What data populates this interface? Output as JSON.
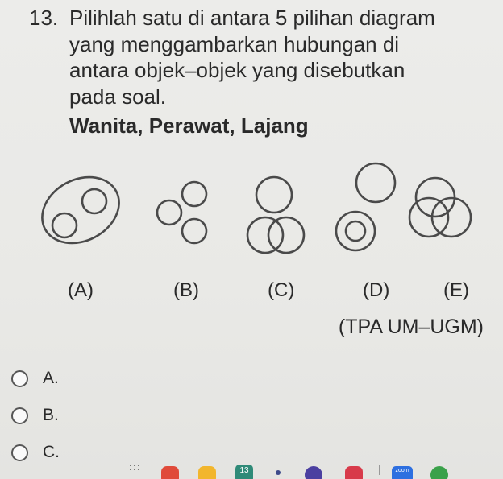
{
  "question": {
    "number": "13.",
    "lines": [
      "Pilihlah satu di antara 5 pilihan diagram",
      "yang menggambarkan hubungan di",
      "antara objek–objek yang disebutkan",
      "pada soal."
    ],
    "keywords": "Wanita, Perawat, Lajang"
  },
  "diagram_labels": [
    "(A)",
    "(B)",
    "(C)",
    "(D)",
    "(E)"
  ],
  "source": "(TPA UM–UGM)",
  "options": [
    {
      "label": "A."
    },
    {
      "label": "B."
    },
    {
      "label": "C."
    }
  ],
  "toolbar": {
    "calendar_day": "13",
    "zoom_label": "zoom"
  }
}
